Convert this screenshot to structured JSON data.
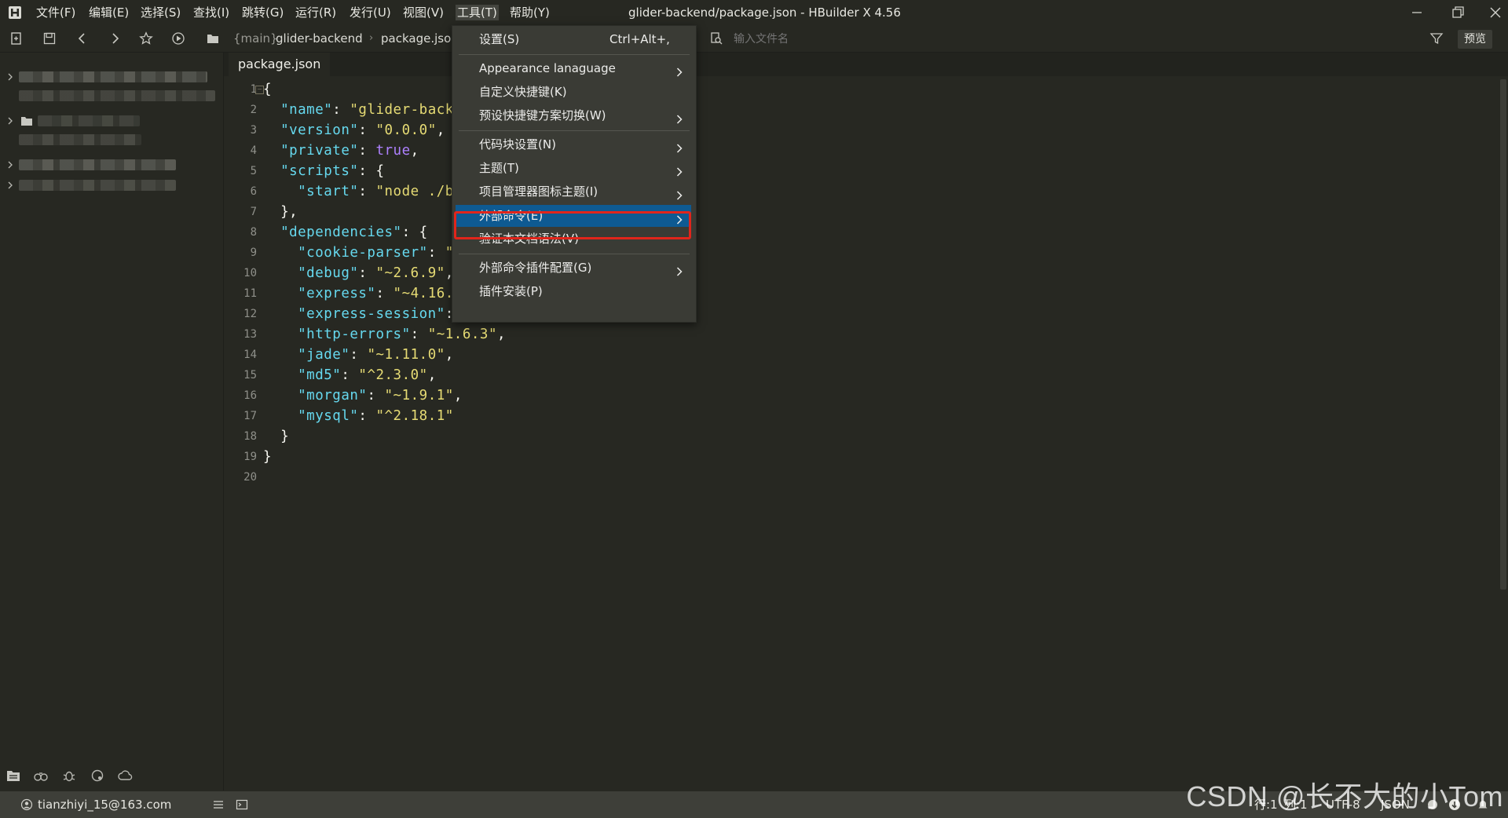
{
  "titlebar": {
    "title": "glider-backend/package.json - HBuilder X 4.56",
    "menus": [
      "文件(F)",
      "编辑(E)",
      "选择(S)",
      "查找(I)",
      "跳转(G)",
      "运行(R)",
      "发行(U)",
      "视图(V)",
      "工具(T)",
      "帮助(Y)"
    ],
    "active_menu": "工具(T)"
  },
  "toolbar": {
    "breadcrumb_branch": "{main}",
    "breadcrumb_project": "glider-backend",
    "breadcrumb_file": "package.json",
    "search_placeholder": "输入文件名",
    "preview_label": "预览"
  },
  "editor": {
    "tab_label": "package.json",
    "line_numbers": [
      "1",
      "2",
      "3",
      "4",
      "5",
      "6",
      "7",
      "8",
      "9",
      "10",
      "11",
      "12",
      "13",
      "14",
      "15",
      "16",
      "17",
      "18",
      "19",
      "20"
    ],
    "lines": [
      [
        {
          "t": "p",
          "v": "{"
        }
      ],
      [
        {
          "t": "k",
          "v": "  \"name\""
        },
        {
          "t": "p",
          "v": ": "
        },
        {
          "t": "s",
          "v": "\"glider-back"
        }
      ],
      [
        {
          "t": "k",
          "v": "  \"version\""
        },
        {
          "t": "p",
          "v": ": "
        },
        {
          "t": "s",
          "v": "\"0.0.0\""
        },
        {
          "t": "p",
          "v": ","
        }
      ],
      [
        {
          "t": "k",
          "v": "  \"private\""
        },
        {
          "t": "p",
          "v": ": "
        },
        {
          "t": "b",
          "v": "true"
        },
        {
          "t": "p",
          "v": ","
        }
      ],
      [
        {
          "t": "k",
          "v": "  \"scripts\""
        },
        {
          "t": "p",
          "v": ": {"
        }
      ],
      [
        {
          "t": "k",
          "v": "    \"start\""
        },
        {
          "t": "p",
          "v": ": "
        },
        {
          "t": "s",
          "v": "\"node ./b"
        }
      ],
      [
        {
          "t": "p",
          "v": "  },"
        }
      ],
      [
        {
          "t": "k",
          "v": "  \"dependencies\""
        },
        {
          "t": "p",
          "v": ": {"
        }
      ],
      [
        {
          "t": "k",
          "v": "    \"cookie-parser\""
        },
        {
          "t": "p",
          "v": ": "
        },
        {
          "t": "s",
          "v": "\""
        }
      ],
      [
        {
          "t": "k",
          "v": "    \"debug\""
        },
        {
          "t": "p",
          "v": ": "
        },
        {
          "t": "s",
          "v": "\"~2.6.9\""
        },
        {
          "t": "p",
          "v": ","
        }
      ],
      [
        {
          "t": "k",
          "v": "    \"express\""
        },
        {
          "t": "p",
          "v": ": "
        },
        {
          "t": "s",
          "v": "\"~4.16."
        }
      ],
      [
        {
          "t": "k",
          "v": "    \"express-session\""
        },
        {
          "t": "p",
          "v": ":"
        }
      ],
      [
        {
          "t": "k",
          "v": "    \"http-errors\""
        },
        {
          "t": "p",
          "v": ": "
        },
        {
          "t": "s",
          "v": "\"~1.6.3\""
        },
        {
          "t": "p",
          "v": ","
        }
      ],
      [
        {
          "t": "k",
          "v": "    \"jade\""
        },
        {
          "t": "p",
          "v": ": "
        },
        {
          "t": "s",
          "v": "\"~1.11.0\""
        },
        {
          "t": "p",
          "v": ","
        }
      ],
      [
        {
          "t": "k",
          "v": "    \"md5\""
        },
        {
          "t": "p",
          "v": ": "
        },
        {
          "t": "s",
          "v": "\"^2.3.0\""
        },
        {
          "t": "p",
          "v": ","
        }
      ],
      [
        {
          "t": "k",
          "v": "    \"morgan\""
        },
        {
          "t": "p",
          "v": ": "
        },
        {
          "t": "s",
          "v": "\"~1.9.1\""
        },
        {
          "t": "p",
          "v": ","
        }
      ],
      [
        {
          "t": "k",
          "v": "    \"mysql\""
        },
        {
          "t": "p",
          "v": ": "
        },
        {
          "t": "s",
          "v": "\"^2.18.1\""
        }
      ],
      [
        {
          "t": "p",
          "v": "  }"
        }
      ],
      [
        {
          "t": "p",
          "v": "}"
        }
      ],
      []
    ]
  },
  "tools_menu": {
    "items": [
      {
        "label": "设置(S)",
        "shortcut": "Ctrl+Alt+,",
        "submenu": false
      },
      {
        "separator": true
      },
      {
        "label": "Appearance lanaguage",
        "submenu": true
      },
      {
        "label": "自定义快捷键(K)",
        "submenu": false
      },
      {
        "label": "预设快捷键方案切换(W)",
        "submenu": true
      },
      {
        "separator": true
      },
      {
        "label": "代码块设置(N)",
        "submenu": true
      },
      {
        "label": "主题(T)",
        "submenu": true
      },
      {
        "label": "项目管理器图标主题(I)",
        "submenu": true
      },
      {
        "label": "外部命令(E)",
        "submenu": true,
        "selected": true
      },
      {
        "label": "验证本文档语法(V)",
        "submenu": false
      },
      {
        "separator": true
      },
      {
        "label": "外部命令插件配置(G)",
        "submenu": true
      },
      {
        "label": "插件安装(P)",
        "submenu": false
      }
    ]
  },
  "statusbar": {
    "account": "tianzhiyi_15@163.com",
    "line": "行:1",
    "col": "列:1",
    "encoding": "UTF-8",
    "language": "JSON"
  },
  "watermark": "CSDN @长不大的小Tom",
  "colors": {
    "background": "#272822",
    "menu_selected": "#0e5a92",
    "highlight_border": "#e1251b",
    "json_key": "#66d9ef",
    "json_string": "#e6db74",
    "json_bool": "#ae81ff"
  }
}
